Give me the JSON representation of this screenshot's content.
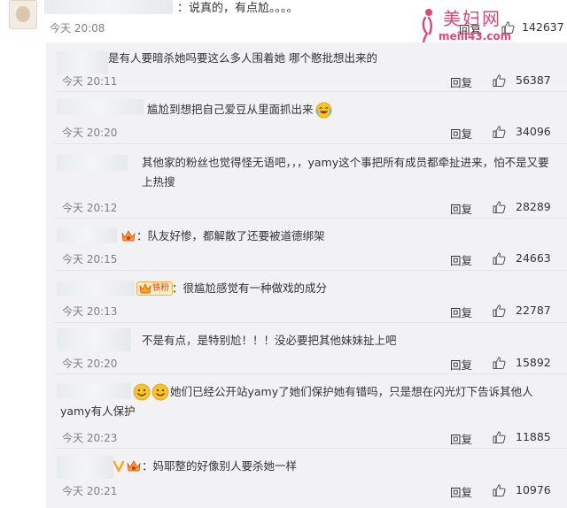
{
  "top_comment": {
    "text": "：说真的，有点尬。。。。",
    "time": "今天 20:08",
    "reply_label": "回复",
    "likes": "142637"
  },
  "watermark": {
    "text": "美妇网",
    "url": "meili43.com"
  },
  "replies": [
    {
      "text": "是有人要暗杀她吗要这么多人围着她 哪个憨批想出来的",
      "time": "今天 20:11",
      "reply_label": "回复",
      "likes": "56387"
    },
    {
      "text": "尴尬到想把自己爱豆从里面抓出来",
      "time": "今天 20:20",
      "reply_label": "回复",
      "likes": "34096"
    },
    {
      "text": "其他家的粉丝也觉得怪无语吧，，，yamy这个事把所有成员都牵扯进来，怕不是又要上热搜",
      "time": "今天 20:12",
      "reply_label": "回复",
      "likes": "28289"
    },
    {
      "text": "：队友好惨，都解散了还要被道德绑架",
      "time": "今天 20:15",
      "reply_label": "回复",
      "likes": "24663"
    },
    {
      "text": "：很尴尬感觉有一种做戏的成分",
      "badge_label": "铁粉",
      "time": "今天 20:13",
      "reply_label": "回复",
      "likes": "22787"
    },
    {
      "text": "不是有点，是特别尬！！！没必要把其他妹妹扯上吧",
      "time": "今天 20:20",
      "reply_label": "回复",
      "likes": "15892"
    },
    {
      "text": "她们已经公开站yamy了她们保护她有错吗，只是想在闪光灯下告诉其他人yamy有人保护",
      "time": "今天 20:23",
      "reply_label": "回复",
      "likes": "11885"
    },
    {
      "text": "：妈耶整的好像别人要杀她一样",
      "time": "今天 20:21",
      "reply_label": "回复",
      "likes": "10976"
    }
  ]
}
